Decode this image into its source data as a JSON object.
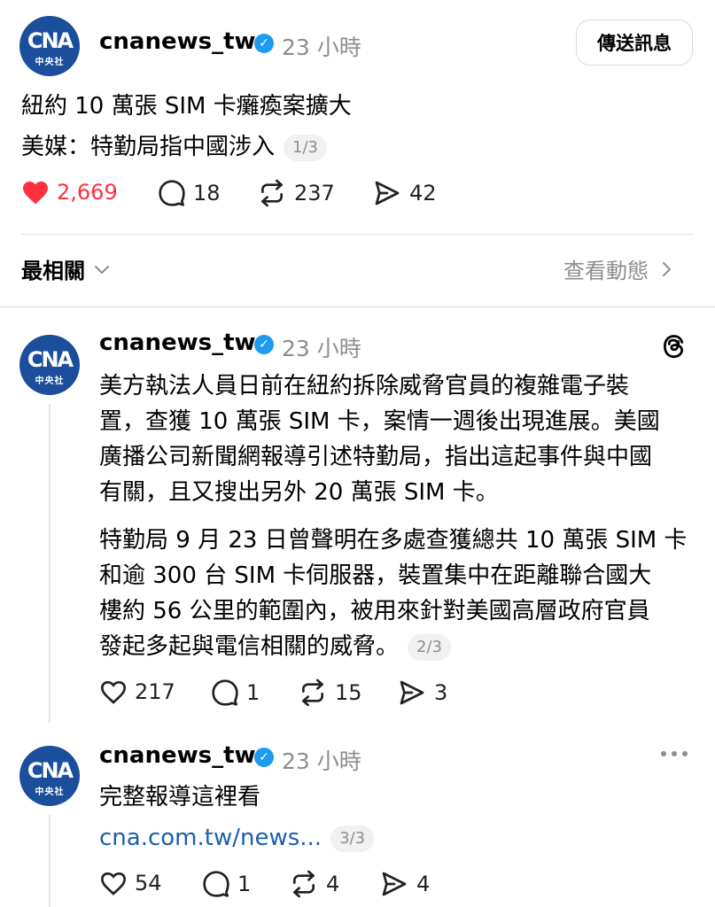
{
  "header": {
    "username": "cnanews_tw",
    "time": "23 小時",
    "send_message_label": "傳送訊息"
  },
  "avatar_logo": {
    "main": "CNA",
    "sub": "中央社"
  },
  "main_post": {
    "line1": "紐約 10 萬張 SIM 卡癱瘓案擴大",
    "line2": "美媒：特勤局指中國涉入",
    "page": "1/3",
    "likes": "2,669",
    "comments": "18",
    "reposts": "237",
    "shares": "42"
  },
  "sort_bar": {
    "label": "最相關",
    "view_activity": "查看動態"
  },
  "reply1": {
    "username": "cnanews_tw",
    "time": "23 小時",
    "para1_lines": [
      "美方執法人員日前在紐約拆除威脅官員的複雜電子裝",
      "置，查獲 10 萬張 SIM 卡，案情一週後出現進展。美國",
      "廣播公司新聞網報導引述特勤局，指出這起事件與中國",
      "有關，且又搜出另外 20 萬張 SIM 卡。"
    ],
    "para2_lines": [
      "特勤局 9 月 23 日曾聲明在多處查獲總共 10 萬張 SIM 卡",
      "和逾 300 台 SIM 卡伺服器，裝置集中在距離聯合國大",
      "樓約 56 公里的範圍內，被用來針對美國高層政府官員",
      "發起多起與電信相關的威脅。"
    ],
    "page": "2/3",
    "likes": "217",
    "comments": "1",
    "reposts": "15",
    "shares": "3"
  },
  "reply2": {
    "username": "cnanews_tw",
    "time": "23 小時",
    "text": "完整報導這裡看",
    "link": "cna.com.tw/news...",
    "page": "3/3",
    "likes": "54",
    "comments": "1",
    "reposts": "4",
    "shares": "4"
  },
  "colors": {
    "like_red": "#ff3040",
    "verified_blue": "#1d9bf0",
    "link_blue": "#1b5fae",
    "avatar_blue": "#1b4f9c"
  },
  "icons": [
    "heart-icon",
    "comment-icon",
    "repost-icon",
    "share-icon",
    "verified-icon",
    "threads-icon",
    "more-icon",
    "chevron-down-icon",
    "chevron-right-icon"
  ]
}
